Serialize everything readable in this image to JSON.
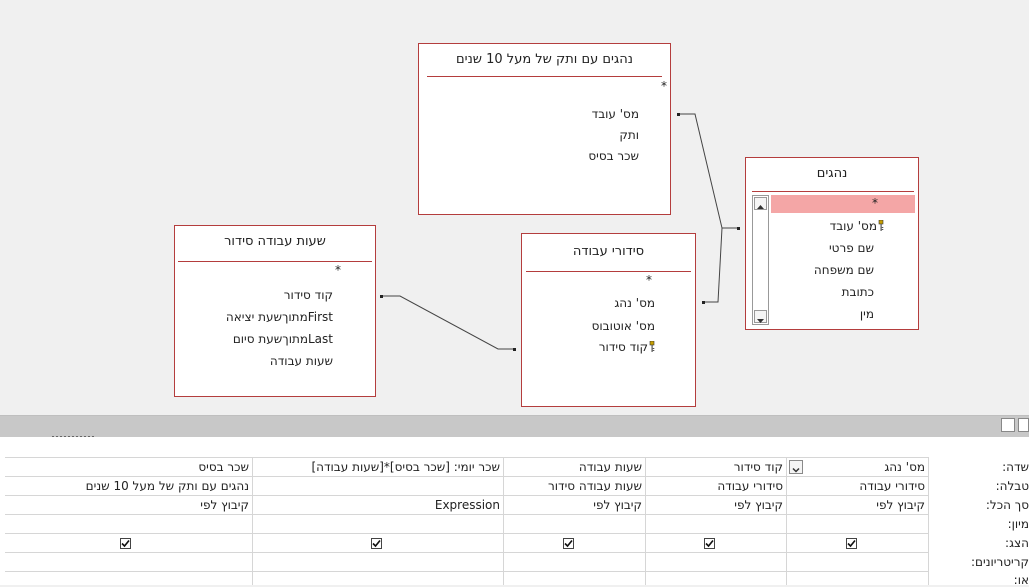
{
  "tables": {
    "drivers_10y": {
      "title": "נהגים עם ותק של מעל 10 שנים",
      "star": "*",
      "fields": [
        "מס' עובד",
        "ותק",
        "שכר בסיס"
      ]
    },
    "drivers": {
      "title": "נהגים",
      "star": "*",
      "fields": [
        "מס' עובד",
        "שם פרטי",
        "שם משפחה",
        "כתובת",
        "מין"
      ]
    },
    "work_hours": {
      "title": "שעות עבודה סידור",
      "star": "*",
      "fields": [
        "קוד סידור",
        "Firstמתוךשעת יציאה",
        "Lastמתוךשעת סיום",
        "שעות עבודה"
      ]
    },
    "arrangements": {
      "title": "סידורי עבודה",
      "star": "*",
      "fields": [
        "מס' נהג",
        "מס' אוטובוס",
        "קוד סידור"
      ]
    }
  },
  "grid": {
    "row_labels": [
      "שדה:",
      "טבלה:",
      "סך הכל:",
      "מיון:",
      "הצג:",
      "קריטריונים:",
      "או:"
    ],
    "columns": [
      {
        "field": "מס' נהג",
        "table": "סידורי עבודה",
        "total": "קיבוץ לפי",
        "show": true
      },
      {
        "field": "קוד סידור",
        "table": "סידורי עבודה",
        "total": "קיבוץ לפי",
        "show": true
      },
      {
        "field": "שעות עבודה",
        "table": "שעות עבודה סידור",
        "total": "קיבוץ לפי",
        "show": true
      },
      {
        "field": "שכר יומי: [שכר בסיס]*[שעות עבודה]",
        "table": "",
        "total": "Expression",
        "show": true
      },
      {
        "field": "שכר בסיס",
        "table": "נהגים עם ותק של מעל 10 שנים",
        "total": "קיבוץ לפי",
        "show": true
      }
    ]
  },
  "colors": {
    "table_border": "#b43d3d",
    "selected_row": "#f4a6a6",
    "canvas": "#f0f0f0"
  }
}
